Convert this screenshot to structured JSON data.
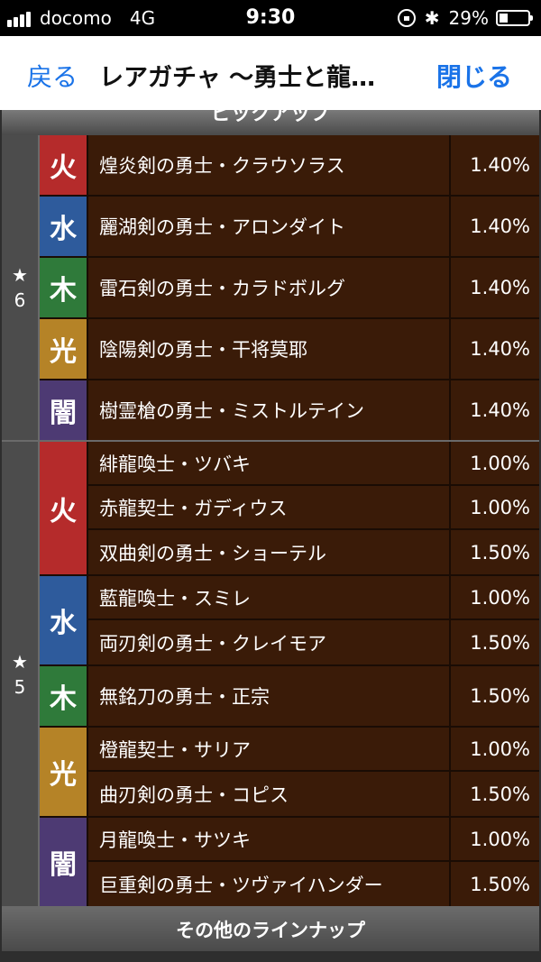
{
  "status_bar": {
    "carrier": "docomo",
    "network": "4G",
    "time": "9:30",
    "battery": "29%",
    "battery_level": 0.29,
    "icons": [
      "signal-icon",
      "rotation-lock-icon",
      "bluetooth-icon",
      "battery-icon"
    ]
  },
  "nav": {
    "back_label": "戻る",
    "title": "レアガチャ 〜勇士と龍…",
    "close_label": "閉じる"
  },
  "pickup_header": "ピックアップ",
  "other_lineup_label": "その他のラインナップ",
  "colors": {
    "fire": "#b52b2b",
    "water": "#2e5b9c",
    "wood": "#2f7a3a",
    "light": "#b58327",
    "dark": "#4d3a73",
    "row_bg": "#3a1b08"
  },
  "rarity6": {
    "star": "★",
    "level": "6",
    "groups": [
      {
        "element": "火",
        "items": [
          {
            "name": "煌炎剣の勇士・クラウソラス",
            "rate": "1.40%"
          }
        ]
      },
      {
        "element": "水",
        "items": [
          {
            "name": "麗湖剣の勇士・アロンダイト",
            "rate": "1.40%"
          }
        ]
      },
      {
        "element": "木",
        "items": [
          {
            "name": "雷石剣の勇士・カラドボルグ",
            "rate": "1.40%"
          }
        ]
      },
      {
        "element": "光",
        "items": [
          {
            "name": "陰陽剣の勇士・干将莫耶",
            "rate": "1.40%"
          }
        ]
      },
      {
        "element": "闇",
        "items": [
          {
            "name": "樹霊槍の勇士・ミストルテイン",
            "rate": "1.40%"
          }
        ]
      }
    ]
  },
  "rarity5": {
    "star": "★",
    "level": "5",
    "groups": [
      {
        "element": "火",
        "items": [
          {
            "name": "緋龍喚士・ツバキ",
            "rate": "1.00%"
          },
          {
            "name": "赤龍契士・ガディウス",
            "rate": "1.00%"
          },
          {
            "name": "双曲剣の勇士・ショーテル",
            "rate": "1.50%"
          }
        ]
      },
      {
        "element": "水",
        "items": [
          {
            "name": "藍龍喚士・スミレ",
            "rate": "1.00%"
          },
          {
            "name": "両刃剣の勇士・クレイモア",
            "rate": "1.50%"
          }
        ]
      },
      {
        "element": "木",
        "items": [
          {
            "name": "無銘刀の勇士・正宗",
            "rate": "1.50%"
          }
        ]
      },
      {
        "element": "光",
        "items": [
          {
            "name": "橙龍契士・サリア",
            "rate": "1.00%"
          },
          {
            "name": "曲刃剣の勇士・コピス",
            "rate": "1.50%"
          }
        ]
      },
      {
        "element": "闇",
        "items": [
          {
            "name": "月龍喚士・サツキ",
            "rate": "1.00%"
          },
          {
            "name": "巨重剣の勇士・ツヴァイハンダー",
            "rate": "1.50%"
          }
        ]
      }
    ]
  }
}
